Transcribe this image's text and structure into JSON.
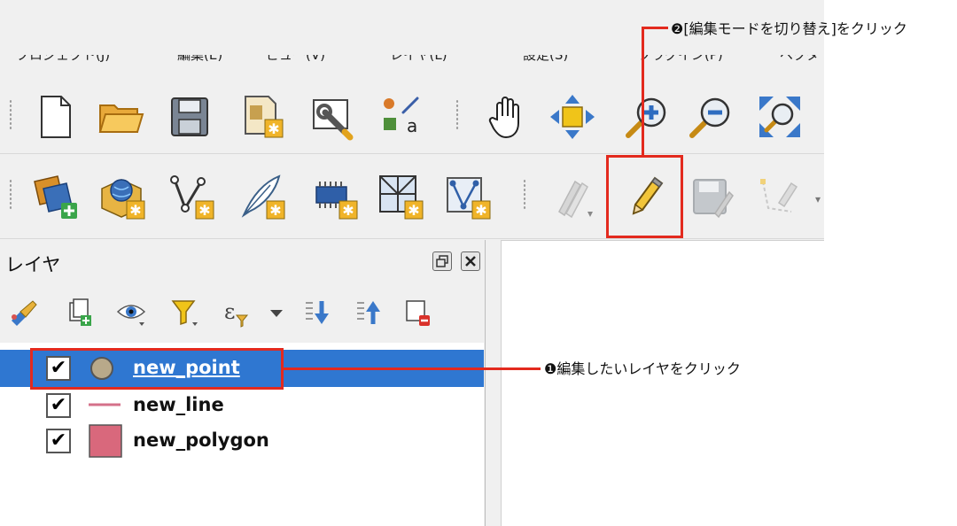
{
  "menubar": {
    "items": [
      "プロジェクト(J)",
      "編集(E)",
      "ビュー(V)",
      "レイヤ(L)",
      "設定(S)",
      "プラグイン(P)",
      "ベクタ"
    ]
  },
  "toolbar1": {
    "buttons": [
      "new-project",
      "open-project",
      "save-project",
      "new-print-layout",
      "style-manager",
      "layer-labeling",
      "pan-map",
      "pan-to-selection",
      "zoom-in",
      "zoom-out",
      "zoom-full"
    ]
  },
  "toolbar2": {
    "buttons": [
      "data-source-manager",
      "new-geopackage-layer",
      "new-shapefile-layer",
      "new-spatialite-layer",
      "new-temporary-scratch-layer",
      "new-virtual-layer",
      "new-mesh-layer",
      "current-edits",
      "toggle-editing",
      "save-layer-edits",
      "digitize-tool"
    ]
  },
  "layers_panel": {
    "title": "レイヤ",
    "tools": [
      "open-layer-styling",
      "add-group",
      "manage-map-themes",
      "filter-legend",
      "filter-by-expression",
      "expand-all",
      "collapse-all",
      "remove-layer"
    ],
    "layers": [
      {
        "name": "new_point",
        "checked": "✔",
        "type": "point",
        "selected": true,
        "color": "#b8a98a"
      },
      {
        "name": "new_line",
        "checked": "✔",
        "type": "line",
        "selected": false,
        "color": "#d4708a"
      },
      {
        "name": "new_polygon",
        "checked": "✔",
        "type": "polygon",
        "selected": false,
        "color": "#d9687c"
      }
    ]
  },
  "annotations": {
    "step1": "❶編集したいレイヤをクリック",
    "step2": "❷[編集モードを切り替え]をクリック",
    "color": "#e32a1e"
  }
}
